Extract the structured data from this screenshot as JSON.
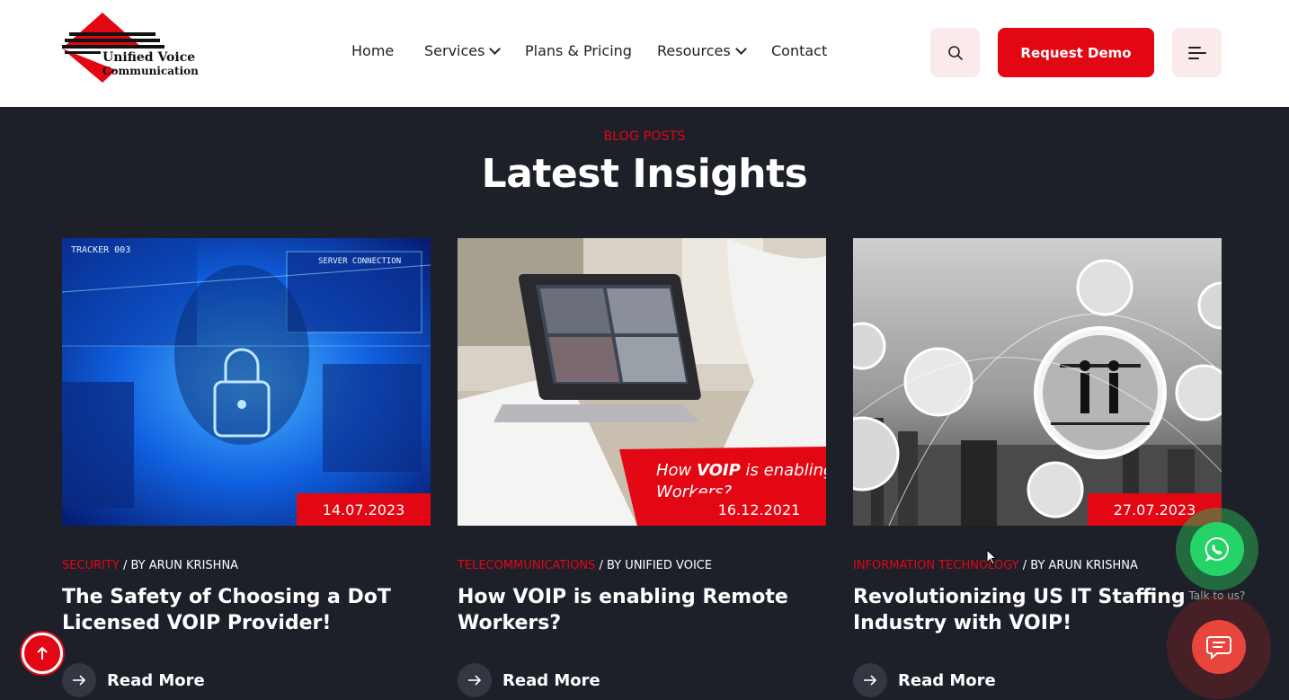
{
  "header": {
    "logo": {
      "line1": "Unified Voice",
      "line2": "Communication"
    },
    "nav": [
      {
        "label": "Home",
        "has_dropdown": false
      },
      {
        "label": "Services",
        "has_dropdown": true
      },
      {
        "label": "Plans & Pricing",
        "has_dropdown": false
      },
      {
        "label": "Resources",
        "has_dropdown": true
      },
      {
        "label": "Contact",
        "has_dropdown": false
      }
    ],
    "search_icon": "search-icon",
    "demo_label": "Request Demo",
    "menu_icon": "hamburger-menu-icon"
  },
  "section": {
    "eyebrow": "BLOG POSTS",
    "title": "Latest Insights"
  },
  "posts": [
    {
      "date": "14.07.2023",
      "category": "SECURITY",
      "byline": " / BY ARUN KRISHNA",
      "title": "The Safety of Choosing a DoT Licensed VOIP Provider!",
      "read_more": "Read More",
      "image_text": [
        "TRACKER 003",
        "SERVER CONNECTION"
      ]
    },
    {
      "date": "16.12.2021",
      "category": "TELECOMMUNICATIONS",
      "byline": " / BY UNIFIED VOICE",
      "title": "How VOIP is enabling Remote Workers?",
      "read_more": "Read More",
      "image_overlay": {
        "prefix": "How ",
        "bold": "VOIP",
        "suffix": " is enabling",
        "line2": "Workers?"
      }
    },
    {
      "date": "27.07.2023",
      "category": "INFORMATION TECHNOLOGY",
      "byline": " / BY ARUN KRISHNA",
      "title": "Revolutionizing US IT Staffing Industry with VOIP!",
      "read_more": "Read More"
    }
  ],
  "floating": {
    "scroll_top_icon": "arrow-up-icon",
    "whatsapp_icon": "whatsapp-icon",
    "talk_label": "Talk to us?",
    "chat_icon": "chat-icon"
  },
  "colors": {
    "brand_red": "#e30613",
    "dark_bg": "#1d2029",
    "whatsapp_green": "#25d366"
  }
}
